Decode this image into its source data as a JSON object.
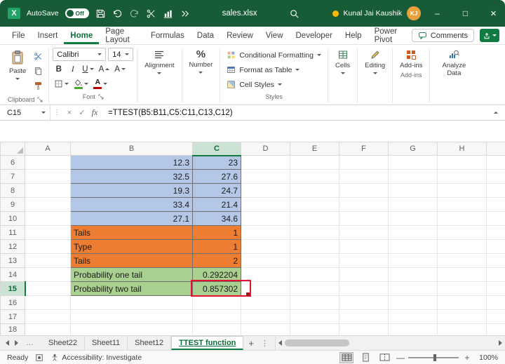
{
  "colors": {
    "titlebar_green": "#185C37",
    "accent_green": "#107C41",
    "blue_fill": "#B4C7E7",
    "orange_fill": "#ED7D31",
    "green_fill": "#A9D08E",
    "annotation_red": "#E8112D",
    "fill_color_bar": "#4EA72E",
    "font_color_bar": "#C00000",
    "avatar_orange": "#E9A13B"
  },
  "icons": {
    "minimize": "–",
    "maximize": "□",
    "close": "×",
    "cancel": "×",
    "enter": "✓",
    "dots_vertical": "⋮",
    "percent": "%",
    "zoom_out": "—",
    "zoom_in": "+"
  },
  "titlebar": {
    "logo_glyph": "X",
    "autosave_label": "AutoSave",
    "autosave_state": "Off",
    "filename": "sales.xlsx",
    "user_name": "Kunal Jai Kaushik",
    "user_initials": "KJ"
  },
  "ribbon": {
    "tabs": [
      "File",
      "Insert",
      "Home",
      "Page Layout",
      "Formulas",
      "Data",
      "Review",
      "View",
      "Developer",
      "Help",
      "Power Pivot"
    ],
    "active_tab": "Home",
    "comments_label": "Comments",
    "clipboard": {
      "label": "Clipboard",
      "paste": "Paste"
    },
    "font": {
      "label": "Font",
      "name": "Calibri",
      "size": "14",
      "bold": "B",
      "italic": "I",
      "underline": "U",
      "grow": "A",
      "shrink": "A",
      "a_glyph": "A"
    },
    "alignment": {
      "label": "Alignment"
    },
    "number": {
      "label": "Number"
    },
    "styles": {
      "label": "Styles",
      "conditional": "Conditional Formatting",
      "format_table": "Format as Table",
      "cell_styles": "Cell Styles"
    },
    "cells": {
      "label": "Cells"
    },
    "editing": {
      "label": "Editing"
    },
    "addins": {
      "label": "Add-ins"
    },
    "analyze": {
      "label": "Analyze Data"
    }
  },
  "formula_bar": {
    "cell_reference": "C15",
    "fx": "fx",
    "formula": "=TTEST(B5:B11,C5:C11,C13,C12)"
  },
  "grid": {
    "columns": [
      "A",
      "B",
      "C",
      "D",
      "E",
      "F",
      "G",
      "H"
    ],
    "selected_column": "C",
    "selected_row": 15,
    "rows": [
      {
        "num": 6,
        "b": "12.3",
        "c": "23",
        "fill": "blue"
      },
      {
        "num": 7,
        "b": "32.5",
        "c": "27.6",
        "fill": "blue"
      },
      {
        "num": 8,
        "b": "19.3",
        "c": "24.7",
        "fill": "blue"
      },
      {
        "num": 9,
        "b": "33.4",
        "c": "21.4",
        "fill": "blue"
      },
      {
        "num": 10,
        "b": "27.1",
        "c": "34.6",
        "fill": "blue"
      },
      {
        "num": 11,
        "b": "Tails",
        "c": "1",
        "fill": "orange"
      },
      {
        "num": 12,
        "b": "Type",
        "c": "1",
        "fill": "orange"
      },
      {
        "num": 13,
        "b": "Tails",
        "c": "2",
        "fill": "orange"
      },
      {
        "num": 14,
        "b": "Probability one tail",
        "c": "0.292204",
        "fill": "green"
      },
      {
        "num": 15,
        "b": "Probability two tail",
        "c": "0.857302",
        "fill": "green",
        "selected": true
      },
      {
        "num": 16,
        "b": "",
        "c": "",
        "fill": "none"
      },
      {
        "num": 17,
        "b": "",
        "c": "",
        "fill": "none"
      },
      {
        "num": 18,
        "b": "",
        "c": "",
        "fill": "none",
        "partial": true
      }
    ]
  },
  "sheet_bar": {
    "overflow": "…",
    "tabs": [
      "Sheet22",
      "Sheet11",
      "Sheet12",
      "TTEST function"
    ],
    "active": "TTEST function",
    "add": "+"
  },
  "status_bar": {
    "ready": "Ready",
    "accessibility": "Accessibility: Investigate",
    "zoom_level": "100%"
  }
}
